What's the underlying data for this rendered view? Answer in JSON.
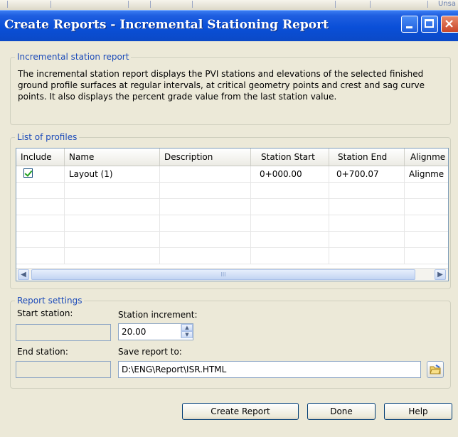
{
  "window": {
    "title": "Create Reports -  Incremental Stationing Report",
    "background_strip_text": "Unsa"
  },
  "info": {
    "group_title": "Incremental station report",
    "description": "The incremental station report displays the PVI stations and elevations of the selected finished ground profile surfaces at regular intervals, at critical geometry points and crest and sag curve points. It also displays the percent grade value from the last station value."
  },
  "profiles": {
    "group_title": "List of profiles",
    "columns": [
      "Include",
      "Name",
      "Description",
      "Station Start",
      "Station End",
      "Alignme"
    ],
    "rows": [
      {
        "include": true,
        "name": "Layout (1)",
        "description": "",
        "station_start": "0+000.00",
        "station_end": "0+700.07",
        "alignment": "Alignme"
      }
    ],
    "scroll_thumb_label": "III"
  },
  "report_settings": {
    "group_title": "Report settings",
    "start_station_label": "Start station:",
    "start_station_value": "",
    "station_increment_label": "Station increment:",
    "station_increment_value": "20.00",
    "end_station_label": "End station:",
    "end_station_value": "",
    "save_to_label": "Save report to:",
    "save_to_value": "D:\\ENG\\Report\\ISR.HTML"
  },
  "buttons": {
    "create": "Create Report",
    "done": "Done",
    "help": "Help"
  },
  "colors": {
    "titlebar": "#0a4fd8",
    "group_title": "#1c4bb9",
    "dialog_bg": "#ece9d8"
  },
  "icons": {
    "browse": "folder-browse-icon",
    "spinner_up": "spin-up-icon",
    "spinner_down": "spin-down-icon",
    "scroll_left": "chevron-left-icon",
    "scroll_right": "chevron-right-icon",
    "checkbox": "checkbox-checked-icon"
  }
}
